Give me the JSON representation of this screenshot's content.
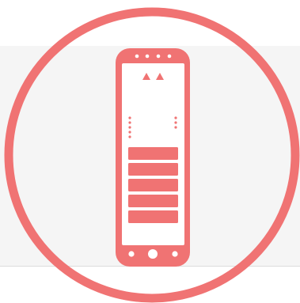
{
  "emblem": {
    "icon": "mobile-device-icon",
    "accent_color": "#f07373",
    "screen_color": "#ffffff",
    "band_color": "#f5f5f5",
    "menu_bar_count": 5
  }
}
